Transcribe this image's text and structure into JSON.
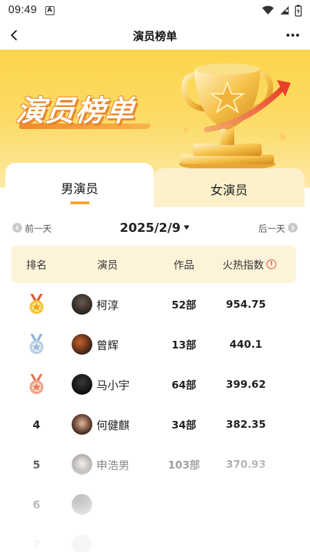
{
  "status_bar": {
    "time": "09:49",
    "notification_icon": "a-badge-icon",
    "icons": [
      "wifi-icon",
      "signal-icon",
      "battery-icon"
    ]
  },
  "nav": {
    "title": "演员榜单",
    "back_icon": "back-arrow-icon",
    "more_icon": "more-icon"
  },
  "banner": {
    "title": "演员榜单",
    "image": "trophy-icon"
  },
  "tabs": [
    {
      "label": "男演员",
      "active": true
    },
    {
      "label": "女演员",
      "active": false
    }
  ],
  "date_nav": {
    "prev_label": "前一天",
    "date": "2025/2/9",
    "next_label": "后一天"
  },
  "table": {
    "headers": {
      "rank": "排名",
      "actor": "演员",
      "works": "作品",
      "heat": "火热指数"
    },
    "rows": [
      {
        "rank": "1",
        "medal": "gold-medal-icon",
        "name": "柯淳",
        "works": "52部",
        "heat": "954.75"
      },
      {
        "rank": "2",
        "medal": "silver-medal-icon",
        "name": "曾辉",
        "works": "13部",
        "heat": "440.1"
      },
      {
        "rank": "3",
        "medal": "bronze-medal-icon",
        "name": "马小宇",
        "works": "64部",
        "heat": "399.62"
      },
      {
        "rank": "4",
        "name": "何健麒",
        "works": "34部",
        "heat": "382.35"
      },
      {
        "rank": "5",
        "name": "申浩男",
        "works": "103部",
        "heat": "370.93"
      },
      {
        "rank": "6",
        "name": "",
        "works": "",
        "heat": ""
      },
      {
        "rank": "7",
        "name": "",
        "works": "",
        "heat": ""
      }
    ]
  },
  "colors": {
    "accent": "#f5a522",
    "banner_bg": "#fbd54a",
    "header_bg": "#fdf3d9",
    "inactive_tab_bg": "#fdf1cc",
    "info_red": "#e0413a"
  }
}
